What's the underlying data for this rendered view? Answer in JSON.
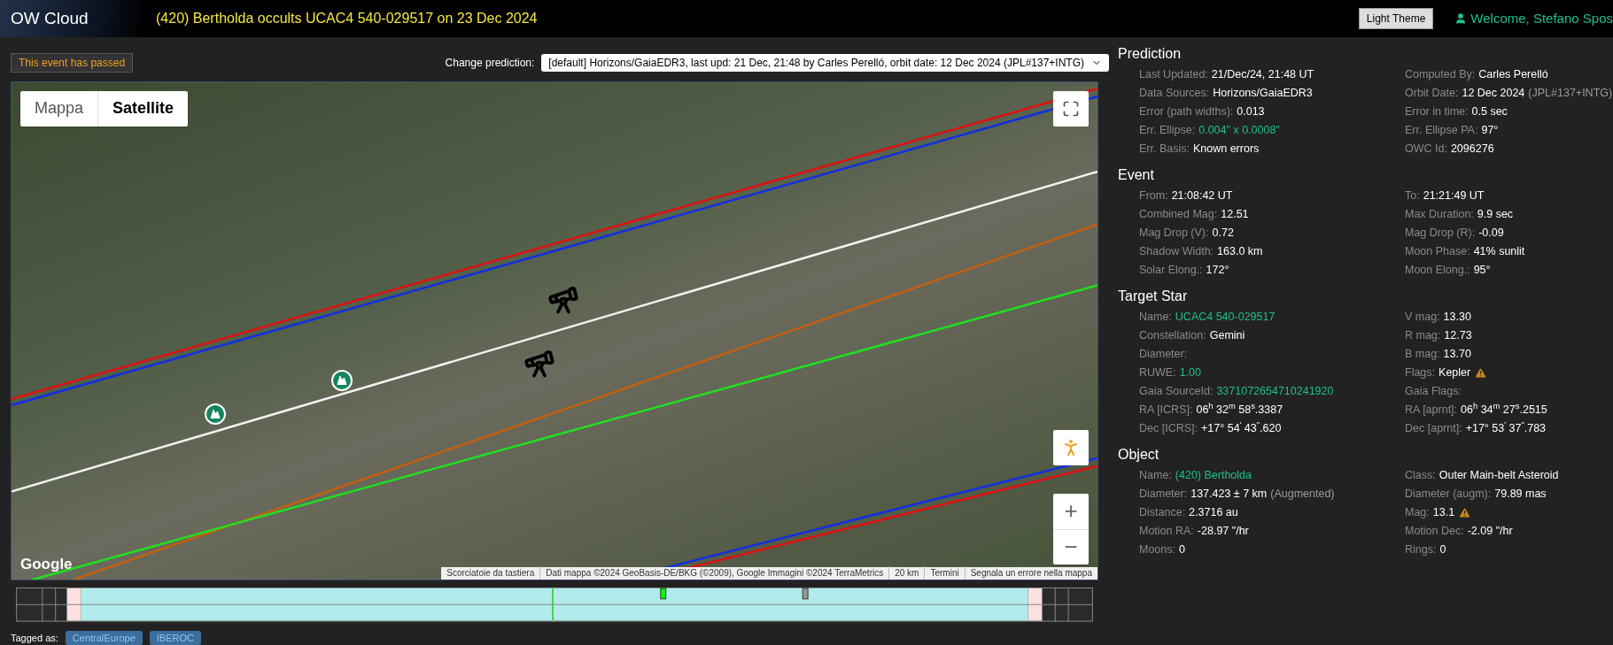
{
  "header": {
    "brand": "OW Cloud",
    "title": "(420) Bertholda occults UCAC4 540-029517 on 23 Dec 2024",
    "theme_button": "Light Theme",
    "welcome": "Welcome, Stefano Spos"
  },
  "event_status": "This event has passed",
  "prediction_select": {
    "label": "Change prediction:",
    "value": "[default] Horizons/GaiaEDR3, last upd: 21 Dec, 21:48 by Carles Perelló, orbit date: 12 Dec 2024 (JPL#137+INTG)"
  },
  "map": {
    "map_types": [
      {
        "label": "Mappa",
        "selected": false
      },
      {
        "label": "Satellite",
        "selected": true
      }
    ],
    "logo": "Google",
    "zoom_in": "+",
    "zoom_out": "−",
    "attribution": [
      "Scorciatoie da tastiera",
      "Dati mappa ©2024 GeoBasis-DE/BKG (©2009), Google Immagini ©2024 TerraMetrics",
      "20 km",
      "Termini",
      "Segnala un errore nella mappa"
    ],
    "paths": [
      {
        "color": "#e01010"
      },
      {
        "color": "#1030e0"
      },
      {
        "color": "#f0f0f0"
      },
      {
        "color": "#c06010"
      },
      {
        "color": "#20e020"
      }
    ]
  },
  "tags": {
    "label": "Tagged as:",
    "items": [
      "CentralEurope",
      "IBEROC"
    ]
  },
  "sections": [
    {
      "title": "Prediction",
      "left": [
        {
          "label": "Last Updated:",
          "value": "21/Dec/24, 21:48 UT"
        },
        {
          "label": "Data Sources:",
          "value": "Horizons/GaiaEDR3"
        },
        {
          "label": "Error (path widths):",
          "value": "0.013"
        },
        {
          "label": "Err. Ellipse:",
          "value": "0.004\" x 0.0008\"",
          "link": true
        },
        {
          "label": "Err. Basis:",
          "value": "Known errors"
        }
      ],
      "right": [
        {
          "label": "Computed By:",
          "value": "Carles Perelló"
        },
        {
          "label": "Orbit Date:",
          "value": "12 Dec 2024",
          "note": "(JPL#137+INTG)"
        },
        {
          "label": "Error in time:",
          "value": "0.5 sec"
        },
        {
          "label": "Err. Ellipse PA:",
          "value": "97°"
        },
        {
          "label": "OWC Id:",
          "value": "2096276"
        }
      ]
    },
    {
      "title": "Event",
      "left": [
        {
          "label": "From:",
          "value": "21:08:42 UT"
        },
        {
          "label": "Combined Mag:",
          "value": "12.51"
        },
        {
          "label": "Mag Drop (V):",
          "value": "0.72"
        },
        {
          "label": "Shadow Width:",
          "value": "163.0 km"
        },
        {
          "label": "Solar Elong.:",
          "value": "172°"
        }
      ],
      "right": [
        {
          "label": "To:",
          "value": "21:21:49 UT"
        },
        {
          "label": "Max Duration:",
          "value": "9.9 sec"
        },
        {
          "label": "Mag Drop (R):",
          "value": "-0.09"
        },
        {
          "label": "Moon Phase:",
          "value": "41% sunlit"
        },
        {
          "label": "Moon Elong.:",
          "value": "95°"
        }
      ]
    },
    {
      "title": "Target Star",
      "left": [
        {
          "label": "Name:",
          "value": "UCAC4 540-029517",
          "link": true
        },
        {
          "label": "Constellation:",
          "value": "Gemini"
        },
        {
          "label": "Diameter:"
        },
        {
          "label": "RUWE:",
          "value": "1.00",
          "link": true
        },
        {
          "label": "Gaia SourceId:",
          "value": "3371072654710241920",
          "link": true
        },
        {
          "label": "RA [ICRS]:",
          "value": "06$^{h}$ 32$^{m}$ 58$^{s}$.3387"
        },
        {
          "label": "Dec [ICRS]:",
          "value": "+17° 54$^{'}$ 43$^{\"}$.620"
        }
      ],
      "right": [
        {
          "label": "V mag:",
          "value": "13.30"
        },
        {
          "label": "R mag:",
          "value": "12.73"
        },
        {
          "label": "B mag:",
          "value": "13.70"
        },
        {
          "label": "Flags:",
          "value": "Kepler",
          "warning": true
        },
        {
          "label": "Gaia Flags:"
        },
        {
          "label": "RA [aprnt]:",
          "value": "06$^{h}$ 34$^{m}$ 27$^{s}$.2515"
        },
        {
          "label": "Dec [aprnt]:",
          "value": "+17° 53$^{'}$ 37$^{\"}$.783"
        }
      ]
    },
    {
      "title": "Object",
      "left": [
        {
          "label": "Name:",
          "value": "(420) Bertholda",
          "link": true
        },
        {
          "label": "Diameter:",
          "value": "137.423 ± 7 km",
          "note": "(Augmented)"
        },
        {
          "label": "Distance:",
          "value": "2.3716 au"
        },
        {
          "label": "Motion RA:",
          "value": "-28.97 \"/hr"
        },
        {
          "label": "Moons:",
          "value": "0"
        }
      ],
      "right": [
        {
          "label": "Class:",
          "value": "Outer Main-belt Asteroid"
        },
        {
          "label": "Diameter (augm):",
          "value": "79.89 mas"
        },
        {
          "label": "Mag:",
          "value": "13.1",
          "warning": true
        },
        {
          "label": "Motion Dec:",
          "value": "-2.09 \"/hr"
        },
        {
          "label": "Rings:",
          "value": "0"
        }
      ]
    }
  ]
}
